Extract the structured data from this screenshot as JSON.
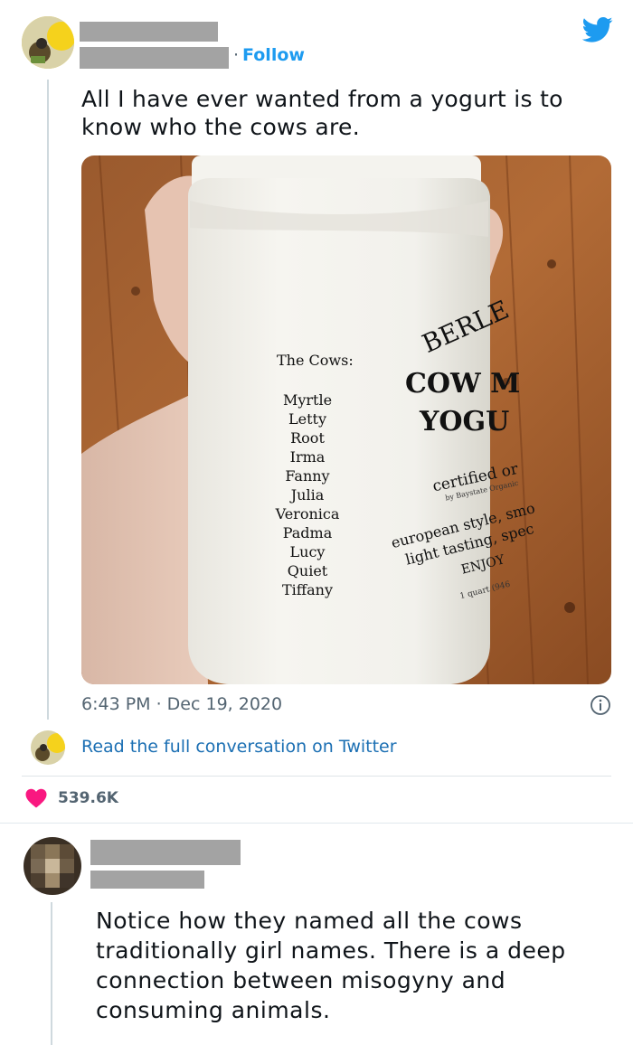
{
  "tweet": {
    "follow_label": "Follow",
    "separator": "·",
    "text": "All I have ever wanted from a yogurt is to know who the cows are.",
    "timestamp": "6:43 PM · Dec 19, 2020",
    "conversation_link": "Read the full conversation on Twitter",
    "like_count": "539.6K",
    "photo": {
      "label_heading": "The Cows:",
      "cow_names": [
        "Myrtle",
        "Letty",
        "Root",
        "Irma",
        "Fanny",
        "Julia",
        "Veronica",
        "Padma",
        "Lucy",
        "Quiet",
        "Tiffany"
      ],
      "brand": "BERLE",
      "product_line1": "COW M",
      "product_line2": "YOGU",
      "certified": "certified or",
      "by_line": "by Baystate Organic",
      "style_line1": "european style, smo",
      "style_line2": "light tasting, spec",
      "enjoy": "ENJOY",
      "quart": "1 quart (946"
    }
  },
  "reply": {
    "text": "Notice how they named all the cows traditionally girl names. There is a deep connection between misogyny and consuming animals."
  },
  "colors": {
    "twitter_blue": "#1d9bf0",
    "link_blue": "#1b6fb3",
    "heart_pink": "#f91880",
    "muted_gray": "#536471",
    "redaction_gray": "#a3a3a3"
  },
  "icons": {
    "brand": "twitter-bird-icon",
    "like": "heart-icon",
    "info": "info-icon"
  }
}
